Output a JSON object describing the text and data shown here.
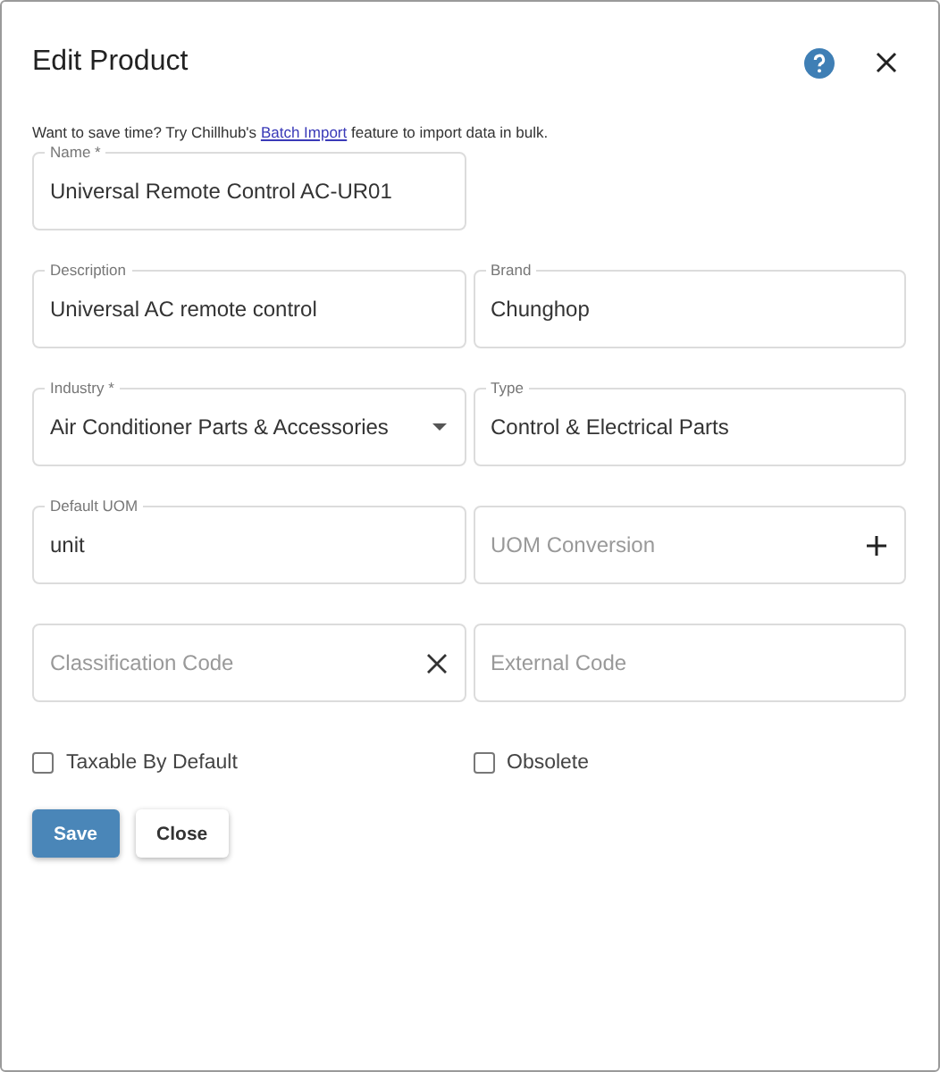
{
  "dialog": {
    "title": "Edit Product"
  },
  "hint": {
    "before": "Want to save time? Try Chillhub's",
    "link": "Batch Import",
    "after": "feature to import data in bulk."
  },
  "rows": [
    [
      {
        "kind": "text",
        "label": "Name *",
        "value": "Universal Remote Control AC-UR01"
      }
    ],
    [
      {
        "kind": "text",
        "label": "Description",
        "value": "Universal AC remote control"
      },
      {
        "kind": "text",
        "label": "Brand",
        "value": "Chunghop"
      }
    ],
    [
      {
        "kind": "select",
        "label": "Industry *",
        "value": "Air Conditioner Parts & Accessories"
      },
      {
        "kind": "text",
        "label": "Type",
        "value": "Control & Electrical Parts"
      }
    ],
    [
      {
        "kind": "text",
        "label": "Default UOM",
        "value": "unit"
      },
      {
        "kind": "add",
        "placeholder": "UOM Conversion"
      }
    ],
    [
      {
        "kind": "clear",
        "placeholder": "Classification Code"
      },
      {
        "kind": "text",
        "placeholder": "External Code"
      }
    ]
  ],
  "checkboxes": [
    {
      "label": "Taxable By Default",
      "checked": false
    },
    {
      "label": "Obsolete",
      "checked": false
    }
  ],
  "buttons": [
    {
      "label": "Save",
      "kind": "primary"
    },
    {
      "label": "Close",
      "kind": "secondary"
    }
  ]
}
